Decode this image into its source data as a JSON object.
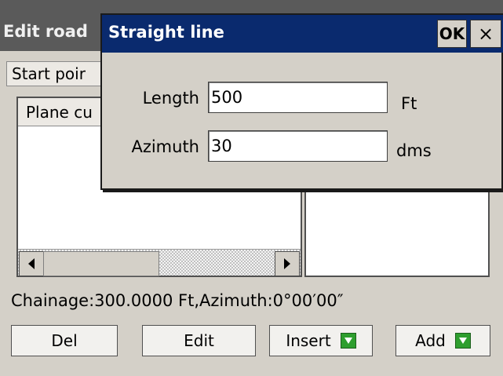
{
  "background_window": {
    "title": "Edit road",
    "start_point_label": "Start poir",
    "list_header": "Plane cu"
  },
  "status": {
    "text": "Chainage:300.0000 Ft,Azimuth:0°00′00″"
  },
  "actions": {
    "del_label": "Del",
    "edit_label": "Edit",
    "insert_label": "Insert",
    "add_label": "Add"
  },
  "dialog": {
    "title": "Straight line",
    "ok_label": "OK",
    "close_label": "×",
    "fields": [
      {
        "label": "Length",
        "value": "500",
        "unit": "Ft"
      },
      {
        "label": "Azimuth",
        "value": "30",
        "unit": "dms"
      }
    ]
  },
  "icons": {
    "scroll_left": "arrow-left-icon",
    "scroll_right": "arrow-right-icon",
    "insert_icon": "green-down-arrow-icon",
    "add_icon": "green-down-arrow-icon"
  },
  "colors": {
    "dialog_title_bg": "#0a2a6e",
    "window_title_bg": "#5a5a5a",
    "icon_green": "#2e9e2e"
  }
}
